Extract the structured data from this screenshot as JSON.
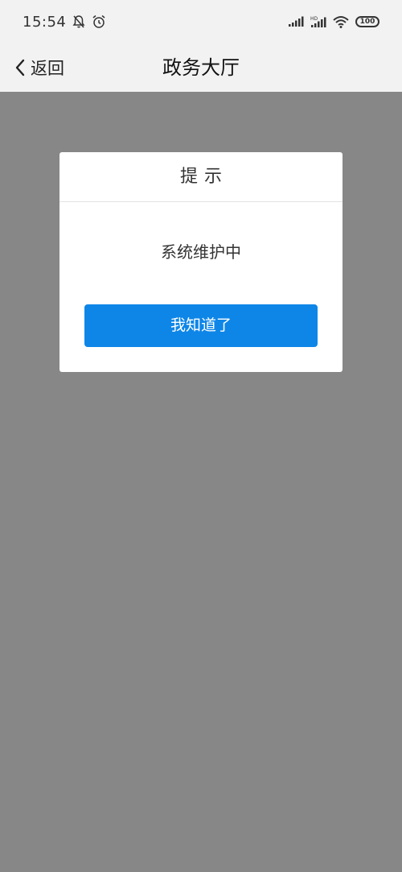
{
  "status_bar": {
    "time": "15:54",
    "battery_level": "100",
    "icons": [
      "bell-off-icon",
      "alarm-icon",
      "signal-icon",
      "hd-signal-icon",
      "wifi-icon",
      "battery-icon"
    ]
  },
  "nav": {
    "back_label": "返回",
    "title": "政务大厅"
  },
  "dialog": {
    "title": "提示",
    "message": "系统维护中",
    "confirm_label": "我知道了"
  },
  "colors": {
    "overlay": "#878787",
    "accent": "#0e86e8",
    "background": "#f2f2f2"
  }
}
